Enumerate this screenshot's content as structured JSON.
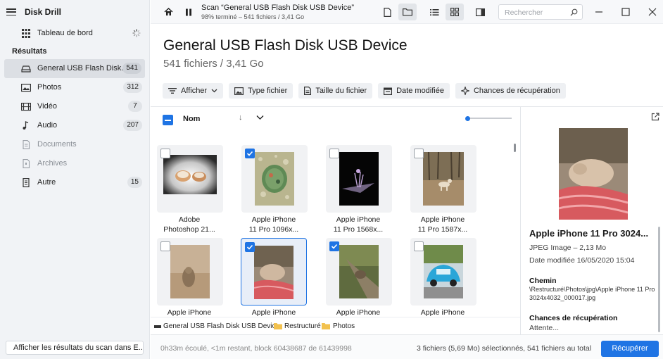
{
  "app": {
    "title": "Disk Drill"
  },
  "sidebar": {
    "dashboard_label": "Tableau de bord",
    "section_label": "Résultats",
    "items": [
      {
        "label": "General USB Flash Disk...",
        "count": "541",
        "icon": "drive-icon"
      },
      {
        "label": "Photos",
        "count": "312",
        "icon": "image-icon"
      },
      {
        "label": "Vidéo",
        "count": "7",
        "icon": "film-icon"
      },
      {
        "label": "Audio",
        "count": "207",
        "icon": "music-note-icon"
      },
      {
        "label": "Documents",
        "count": "",
        "icon": "document-icon"
      },
      {
        "label": "Archives",
        "count": "",
        "icon": "archive-icon"
      },
      {
        "label": "Autre",
        "count": "15",
        "icon": "file-icon"
      }
    ],
    "bottom_button": "Afficher les résultats du scan dans E..."
  },
  "toolbar": {
    "scan_title": "Scan “General USB Flash Disk USB Device”",
    "scan_subtitle": "98% terminé – 541 fichiers / 3,41 Go",
    "search_placeholder": "Rechercher"
  },
  "header": {
    "title": "General USB Flash Disk USB Device",
    "subtitle": "541 fichiers / 3,41 Go",
    "filters": [
      "Afficher",
      "Type fichier",
      "Taille du fichier",
      "Date modifiée",
      "Chances de récupération"
    ]
  },
  "list": {
    "column_name": "Nom",
    "zoom_level": 0.0
  },
  "files": [
    {
      "name1": "Adobe",
      "name2": "Photoshop 21...",
      "checked": false,
      "selected": false
    },
    {
      "name1": "Apple iPhone",
      "name2": "11 Pro 1096x...",
      "checked": true,
      "selected": false
    },
    {
      "name1": "Apple iPhone",
      "name2": "11 Pro 1568x...",
      "checked": false,
      "selected": false
    },
    {
      "name1": "Apple iPhone",
      "name2": "11 Pro 1587x...",
      "checked": false,
      "selected": false
    },
    {
      "name1": "Apple iPhone",
      "name2": "",
      "checked": false,
      "selected": false
    },
    {
      "name1": "Apple iPhone",
      "name2": "",
      "checked": true,
      "selected": true
    },
    {
      "name1": "Apple iPhone",
      "name2": "",
      "checked": true,
      "selected": false
    },
    {
      "name1": "Apple iPhone",
      "name2": "",
      "checked": false,
      "selected": false
    }
  ],
  "pathbar": {
    "drive": "General USB Flash Disk USB Device",
    "folder1": "Restructuré",
    "folder2": "Photos"
  },
  "preview": {
    "title": "Apple iPhone 11 Pro 3024...",
    "type_size": "JPEG Image – 2,13 Mo",
    "date": "Date modifiée 16/05/2020 15:04",
    "path_label": "Chemin",
    "path_value": "\\Restructuré\\Photos\\jpg\\Apple iPhone 11 Pro 3024x4032_000017.jpg",
    "chances_label": "Chances de récupération",
    "chances_value": "Attente..."
  },
  "footer": {
    "status": "0h33m écoulé, <1m restant, block 60438687 de 61439998",
    "selection": "3 fichiers (5,69 Mo) sélectionnés, 541 fichiers au total",
    "recover_button": "Récupérer"
  },
  "colors": {
    "accent": "#1f74e4"
  }
}
